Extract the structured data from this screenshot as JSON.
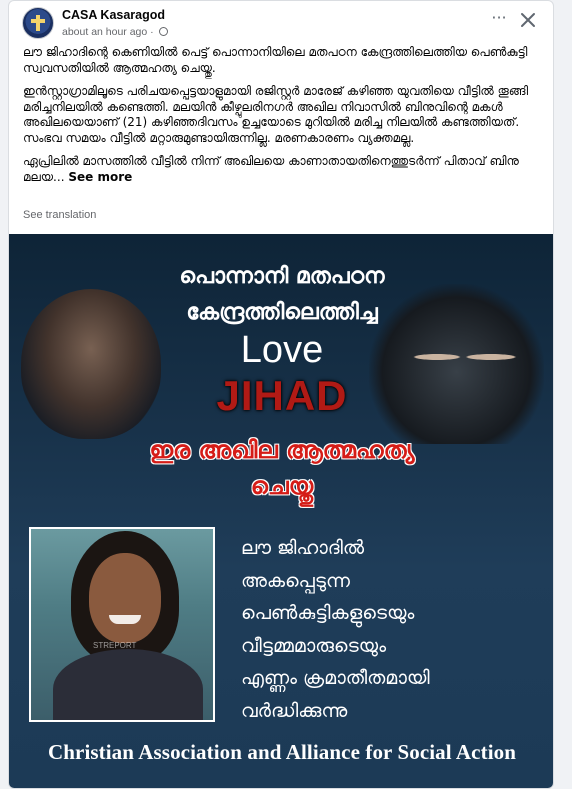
{
  "post": {
    "page_name": "CASA Kasaragod",
    "timestamp": "about an hour ago",
    "privacy_icon": "globe-icon",
    "more_icon": "···",
    "paragraphs": [
      "ലൗ ജിഹാദിന്റെ കെണിയിൽ പെട്ട് പൊന്നാനിയിലെ മതപഠന കേന്ദ്രത്തിലെത്തിയ പെൺകുട്ടി സ്വവസതിയിൽ ആത്മഹത്യ ചെയ്തു.",
      "ഇൻസ്റ്റാഗ്രാമിലൂടെ പരിചയപ്പെട്ടയാളുമായി രജിസ്റ്റർ മാരേജ് കഴിഞ്ഞ യുവതിയെ വീട്ടിൽ തൂങ്ങി മരിച്ചനിലയിൽ കണ്ടെത്തി. മലയിൻ കീഴ്പുലരിനഗർ അഖില നിവാസിൽ ബിനുവിന്റെ മകൾ അഖിലയെയാണ് (21) കഴിഞ്ഞദിവസം ഉച്ചയോടെ മുറിയിൽ മരിച്ച നിലയിൽ കണ്ടത്തിയത്. സംഭവ സമയം വീട്ടിൽ മറ്റാരുമുണ്ടായിരുന്നില്ല. മരണകാരണം വ്യക്തമല്ല.",
      "ഏപ്രിലിൽ മാസത്തിൽ വീട്ടിൽ നിന്ന് അഖിലയെ കാണാതായതിനെത്തുടർന്ന് പിതാവ് ബിനു മലയ..."
    ],
    "see_more": "See more",
    "see_translation": "See translation"
  },
  "poster": {
    "headline_line1": "പൊന്നാനി മതപഠന",
    "headline_line2": "കേന്ദ്രത്തിലെത്തിച്ച",
    "love": "Love",
    "jihad": "JIHAD",
    "red_line1": "ഇര അഖില ആത്മഹത്യ",
    "red_line2": "ചെയ്തു",
    "photo_watermark": "STREPORT",
    "right_lines": [
      "ലൗ ജിഹാദിൽ",
      "അകപ്പെടുന്ന",
      "പെൺകുട്ടികളുടെയും",
      "വീട്ടമ്മമാരുടെയും",
      "എണ്ണം ക്രമാതീതമായി",
      "വർദ്ധിക്കുന്നു"
    ],
    "footer": "Christian Association and Alliance for Social Action"
  },
  "colors": {
    "poster_bg": "#18324a",
    "jihad_red": "#b11a15",
    "headline_red": "#d51c17"
  }
}
